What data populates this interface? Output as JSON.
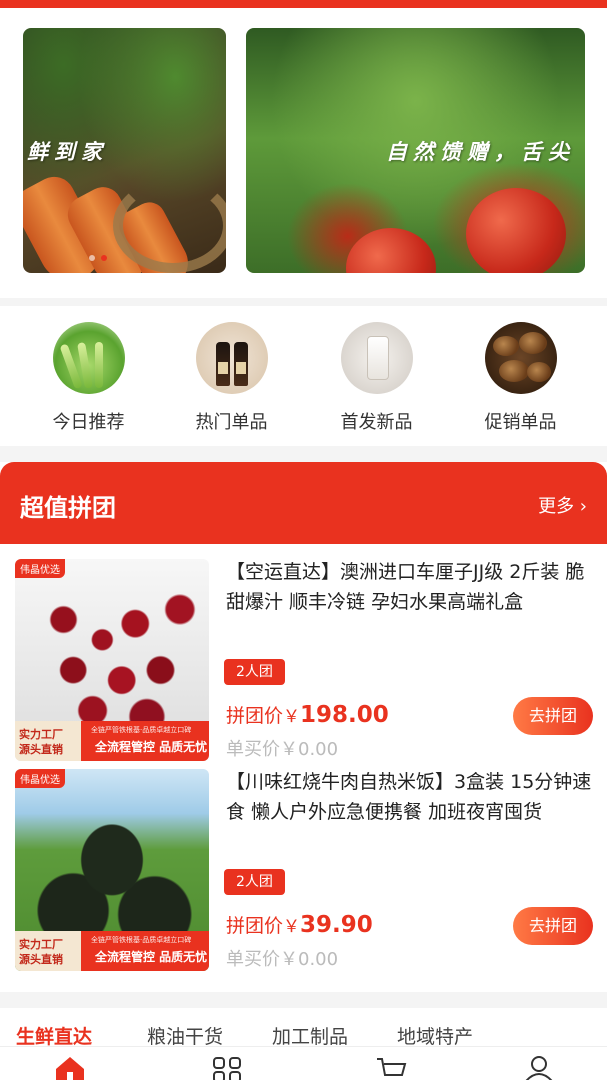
{
  "banners": [
    {
      "text": "鲜到家"
    },
    {
      "text": "自然馈赠，舌尖"
    }
  ],
  "categories": [
    {
      "label": "今日推荐",
      "icon": "celery-image"
    },
    {
      "label": "热门单品",
      "icon": "sauce-bottles-image"
    },
    {
      "label": "首发新品",
      "icon": "jar-image"
    },
    {
      "label": "促销单品",
      "icon": "mushrooms-image"
    }
  ],
  "group_buy": {
    "title": "超值拼团",
    "more": "更多 ›",
    "items": [
      {
        "tag": "伟晶优选",
        "badge_left": [
          "实力工厂",
          "源头直销"
        ],
        "badge_right_small": "全链严管铁根基·品质卓越立口碑",
        "badge_right_big": "全流程管控 品质无忧",
        "title": "【空运直达】澳洲进口车厘子JJ级 2斤装 脆甜爆汁 顺丰冷链 孕妇水果高端礼盒",
        "team": "2人团",
        "price_label": "拼团价",
        "price_currency": "￥",
        "price": "198.00",
        "single_label": "单买价",
        "single_price": "￥0.00",
        "button": "去拼团",
        "image": "cherries-image"
      },
      {
        "tag": "伟晶优选",
        "badge_left": [
          "实力工厂",
          "源头直销"
        ],
        "badge_right_small": "全链严管铁根基·品质卓越立口碑",
        "badge_right_big": "全流程管控 品质无忧",
        "title": "【川味红烧牛肉自热米饭】3盒装 15分钟速食 懒人户外应急便携餐 加班夜宵囤货",
        "team": "2人团",
        "price_label": "拼团价",
        "price_currency": "￥",
        "price": "39.90",
        "single_label": "单买价",
        "single_price": "￥0.00",
        "button": "去拼团",
        "image": "self-heating-rice-image"
      }
    ]
  },
  "tabs": [
    "生鲜直达",
    "粮油干货",
    "加工制品",
    "地域特产"
  ],
  "active_tab": "生鲜直达",
  "bottom_nav": [
    {
      "icon": "home-icon"
    },
    {
      "icon": "category-grid-icon"
    },
    {
      "icon": "cart-icon"
    },
    {
      "icon": "user-icon"
    }
  ],
  "colors": {
    "accent": "#e9321f",
    "disabled": "#bbbbbb"
  }
}
